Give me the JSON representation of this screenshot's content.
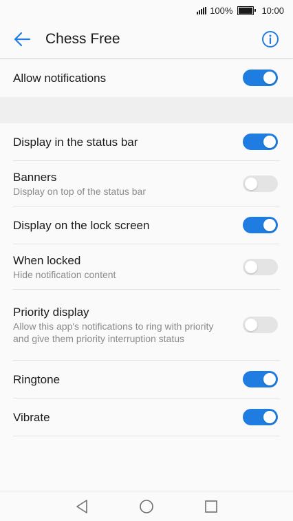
{
  "status_bar": {
    "battery": "100%",
    "time": "10:00"
  },
  "header": {
    "title": "Chess Free",
    "back_icon": "arrow-left-icon",
    "info_icon": "info-icon",
    "accent": "#1f7ce0"
  },
  "allow": {
    "title": "Allow notifications",
    "enabled": true
  },
  "settings": [
    {
      "title": "Display in the status bar",
      "subtitle": "",
      "enabled": true
    },
    {
      "title": "Banners",
      "subtitle": "Display on top of the status bar",
      "enabled": false
    },
    {
      "title": "Display on the lock screen",
      "subtitle": "",
      "enabled": true
    },
    {
      "title": "When locked",
      "subtitle": "Hide notification content",
      "enabled": false
    },
    {
      "title": "Priority display",
      "subtitle": "Allow this app's notifications to ring with priority and give them priority interruption status",
      "enabled": false
    },
    {
      "title": "Ringtone",
      "subtitle": "",
      "enabled": true
    },
    {
      "title": "Vibrate",
      "subtitle": "",
      "enabled": true
    }
  ],
  "nav": {
    "back_icon": "triangle-back-icon",
    "home_icon": "circle-home-icon",
    "recents_icon": "square-recents-icon"
  }
}
